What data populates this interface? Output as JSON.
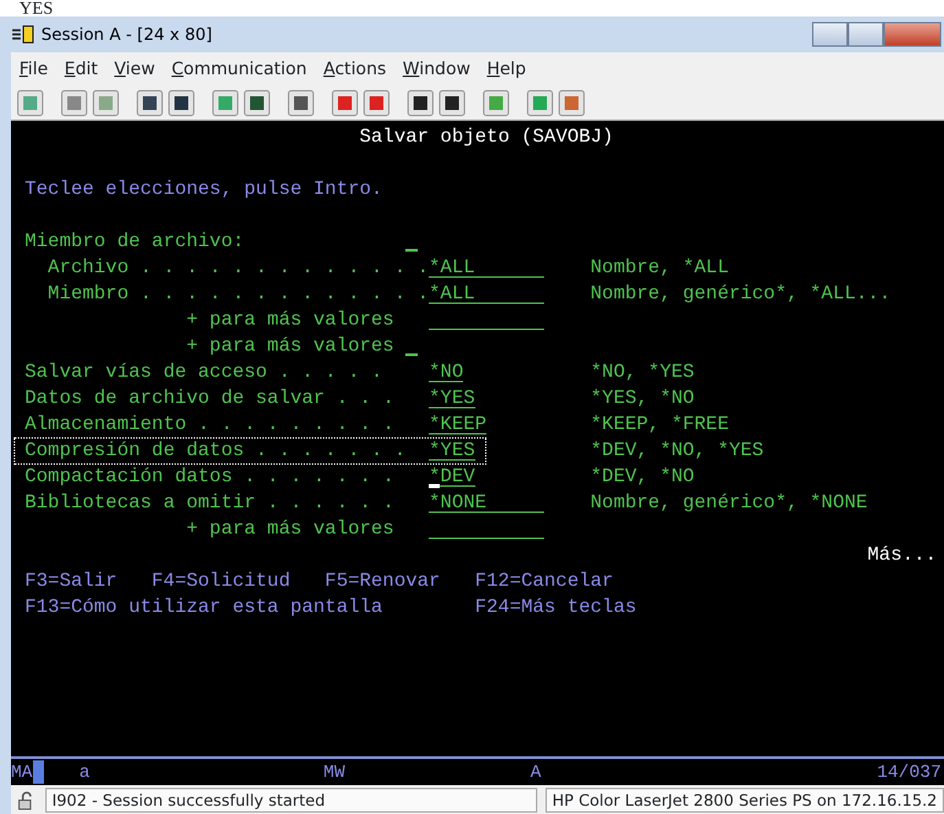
{
  "document_fragment": "YES",
  "window": {
    "title": "Session A - [24 x 80]"
  },
  "menu": [
    "File",
    "Edit",
    "View",
    "Communication",
    "Actions",
    "Window",
    "Help"
  ],
  "screen": {
    "title": "Salvar objeto (SAVOBJ)",
    "instruction": "Teclee elecciones, pulse Intro.",
    "rows": [
      {
        "kind": "group",
        "label": "Miembro de archivo:",
        "selected": false,
        "field": {
          "kind": "single",
          "cursor": false
        },
        "children": [
          {
            "kind": "param",
            "label": "Archivo . . . . . . . . . . . . .",
            "selected": false,
            "field": {
              "value": "*ALL",
              "kind": "long",
              "cursor": false
            },
            "hint": "Nombre, *ALL"
          },
          {
            "kind": "param",
            "label": "Miembro . . . . . . . . . . . . .",
            "selected": false,
            "field": {
              "value": "*ALL",
              "kind": "long",
              "cursor": false
            },
            "hint": "Nombre, genérico*, *ALL..."
          },
          {
            "kind": "more",
            "label": "+ para más valores",
            "selected": false,
            "field": {
              "kind": "long",
              "cursor": false
            }
          },
          {
            "kind": "more",
            "label": "+ para más valores",
            "selected": false,
            "field": {
              "kind": "single",
              "cursor": false
            }
          }
        ]
      },
      {
        "kind": "param",
        "label": "Salvar vías de acceso . . . . .",
        "selected": false,
        "field": {
          "value": "*NO",
          "kind": "short",
          "cursor": false
        },
        "hint": "*NO, *YES"
      },
      {
        "kind": "param",
        "label": "Datos de archivo de salvar . . .",
        "selected": false,
        "field": {
          "value": "*YES",
          "kind": "short",
          "cursor": false
        },
        "hint": "*YES, *NO"
      },
      {
        "kind": "param",
        "label": "Almacenamiento . . . . . . . . .",
        "selected": false,
        "field": {
          "value": "*KEEP",
          "kind": "short",
          "cursor": false
        },
        "hint": "*KEEP, *FREE"
      },
      {
        "kind": "param",
        "label": "Compresión de datos . . . . . . .",
        "selected": true,
        "field": {
          "value": "*YES",
          "kind": "short",
          "cursor": false
        },
        "hint": "*DEV, *NO, *YES"
      },
      {
        "kind": "param",
        "label": "Compactación datos . . . . . . .",
        "selected": false,
        "field": {
          "value": "*DEV",
          "kind": "short",
          "cursor": true
        },
        "hint": "*DEV, *NO"
      },
      {
        "kind": "param",
        "label": "Bibliotecas a omitir . . . . . .",
        "selected": false,
        "field": {
          "value": "*NONE",
          "kind": "long",
          "cursor": false
        },
        "hint": "Nombre, genérico*, *NONE"
      },
      {
        "kind": "more",
        "label": "+ para más valores",
        "selected": false,
        "field": {
          "kind": "long",
          "cursor": false
        }
      }
    ],
    "more": "Más...",
    "function_keys": [
      [
        "F3=Salir",
        "F4=Solicitud",
        "F5=Renovar",
        "F12=Cancelar"
      ],
      [
        "F13=Cómo utilizar esta pantalla",
        "F24=Más teclas"
      ]
    ]
  },
  "oia": {
    "items": [
      "MA",
      "a",
      "MW",
      "A"
    ],
    "position": "14/037"
  },
  "status_bar": {
    "message": "I902 - Session successfully started",
    "printer": "HP Color LaserJet 2800 Series PS on 172.16.15.2"
  }
}
